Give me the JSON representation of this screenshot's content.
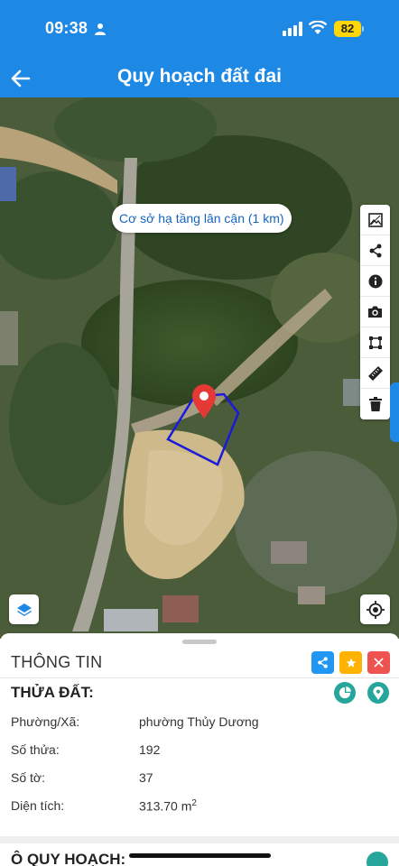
{
  "status_bar": {
    "time": "09:38",
    "battery": "82"
  },
  "header": {
    "title": "Quy hoạch đất đai"
  },
  "map": {
    "nearby_chip": "Cơ sở hạ tầng lân cận (1 km)",
    "tools": [
      "image-icon",
      "share-icon",
      "info-icon",
      "camera-icon",
      "polygon-icon",
      "ruler-icon",
      "trash-icon"
    ],
    "boundary_color": "#1a1adb",
    "pin_color": "#e53935"
  },
  "info_sheet": {
    "heading": "THÔNG TIN",
    "action_colors": {
      "share": "#2196f3",
      "favorite": "#ffb300",
      "close": "#ef5350"
    },
    "parcel": {
      "heading": "THỬA ĐẤT:",
      "rows": [
        {
          "label": "Phường/Xã:",
          "value": "phường Thủy Dương"
        },
        {
          "label": "Số thửa:",
          "value": "192"
        },
        {
          "label": "Số tờ:",
          "value": "37"
        },
        {
          "label": "Diện tích:",
          "value": "313.70 m",
          "unit_sup": "2"
        }
      ]
    },
    "zone_heading": "Ô QUY HOẠCH:"
  },
  "colors": {
    "accent": "#1e88e5",
    "teal": "#26a69a"
  }
}
